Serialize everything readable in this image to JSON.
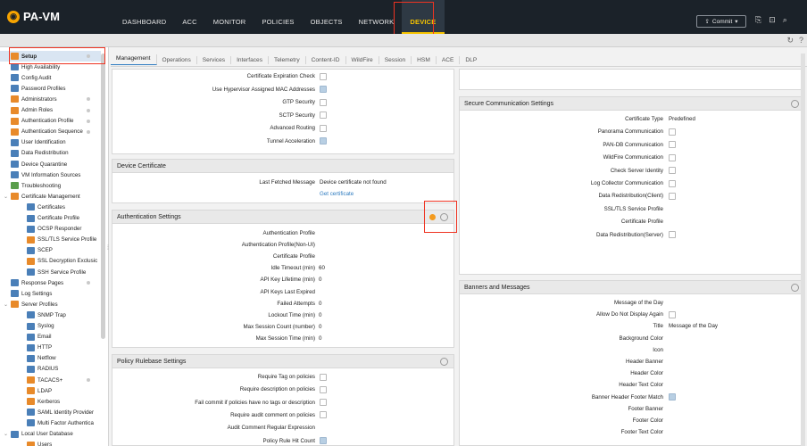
{
  "app": {
    "logo_text": "PA-VM"
  },
  "nav": {
    "items": [
      "DASHBOARD",
      "ACC",
      "MONITOR",
      "POLICIES",
      "OBJECTS",
      "NETWORK",
      "DEVICE"
    ],
    "active": "DEVICE"
  },
  "toolbar": {
    "commit_label": "Commit"
  },
  "sidebar": {
    "items": [
      {
        "label": "Setup",
        "level": 0,
        "icon": "setup-icon",
        "selected": true,
        "dot": true
      },
      {
        "label": "High Availability",
        "level": 0,
        "icon": "ha-icon"
      },
      {
        "label": "Config Audit",
        "level": 0,
        "icon": "audit-icon"
      },
      {
        "label": "Password Profiles",
        "level": 0,
        "icon": "password-icon"
      },
      {
        "label": "Administrators",
        "level": 0,
        "icon": "admin-icon",
        "dot": true
      },
      {
        "label": "Admin Roles",
        "level": 0,
        "icon": "roles-icon",
        "dot": true
      },
      {
        "label": "Authentication Profile",
        "level": 0,
        "icon": "auth-profile-icon",
        "dot": true
      },
      {
        "label": "Authentication Sequence",
        "level": 0,
        "icon": "auth-seq-icon",
        "dot": true
      },
      {
        "label": "User Identification",
        "level": 0,
        "icon": "user-id-icon"
      },
      {
        "label": "Data Redistribution",
        "level": 0,
        "icon": "data-redist-icon"
      },
      {
        "label": "Device Quarantine",
        "level": 0,
        "icon": "quarantine-icon"
      },
      {
        "label": "VM Information Sources",
        "level": 0,
        "icon": "vm-icon"
      },
      {
        "label": "Troubleshooting",
        "level": 0,
        "icon": "troubleshoot-icon"
      },
      {
        "label": "Certificate Management",
        "level": 0,
        "icon": "cert-mgmt-icon",
        "expanded": true
      },
      {
        "label": "Certificates",
        "level": 1,
        "icon": "certificate-icon"
      },
      {
        "label": "Certificate Profile",
        "level": 1,
        "icon": "cert-profile-icon"
      },
      {
        "label": "OCSP Responder",
        "level": 1,
        "icon": "ocsp-icon"
      },
      {
        "label": "SSL/TLS Service Profile",
        "level": 1,
        "icon": "ssl-profile-icon"
      },
      {
        "label": "SCEP",
        "level": 1,
        "icon": "scep-icon"
      },
      {
        "label": "SSL Decryption Exclusic",
        "level": 1,
        "icon": "ssl-excl-icon"
      },
      {
        "label": "SSH Service Profile",
        "level": 1,
        "icon": "ssh-icon"
      },
      {
        "label": "Response Pages",
        "level": 0,
        "icon": "response-icon",
        "dot": true
      },
      {
        "label": "Log Settings",
        "level": 0,
        "icon": "log-icon"
      },
      {
        "label": "Server Profiles",
        "level": 0,
        "icon": "server-profiles-icon",
        "expanded": true
      },
      {
        "label": "SNMP Trap",
        "level": 1,
        "icon": "snmp-icon"
      },
      {
        "label": "Syslog",
        "level": 1,
        "icon": "syslog-icon"
      },
      {
        "label": "Email",
        "level": 1,
        "icon": "email-icon"
      },
      {
        "label": "HTTP",
        "level": 1,
        "icon": "http-icon"
      },
      {
        "label": "Netflow",
        "level": 1,
        "icon": "netflow-icon"
      },
      {
        "label": "RADIUS",
        "level": 1,
        "icon": "radius-icon"
      },
      {
        "label": "TACACS+",
        "level": 1,
        "icon": "tacacs-icon",
        "dot": true
      },
      {
        "label": "LDAP",
        "level": 1,
        "icon": "ldap-icon"
      },
      {
        "label": "Kerberos",
        "level": 1,
        "icon": "kerberos-icon"
      },
      {
        "label": "SAML Identity Provider",
        "level": 1,
        "icon": "saml-icon"
      },
      {
        "label": "Multi Factor Authentica",
        "level": 1,
        "icon": "mfa-icon"
      },
      {
        "label": "Local User Database",
        "level": 0,
        "icon": "local-db-icon",
        "expanded": true
      },
      {
        "label": "Users",
        "level": 1,
        "icon": "users-icon"
      }
    ]
  },
  "tabs": [
    "Management",
    "Operations",
    "Services",
    "Interfaces",
    "Telemetry",
    "Content-ID",
    "WildFire",
    "Session",
    "HSM",
    "ACE",
    "DLP"
  ],
  "general": {
    "rows": [
      {
        "label": "Certificate Expiration Check",
        "checked": false
      },
      {
        "label": "Use Hypervisor Assigned MAC Addresses",
        "checked": true
      },
      {
        "label": "GTP Security",
        "checked": false
      },
      {
        "label": "SCTP Security",
        "checked": false
      },
      {
        "label": "Advanced Routing",
        "checked": false
      },
      {
        "label": "Tunnel Acceleration",
        "checked": true
      }
    ]
  },
  "device_certificate": {
    "title": "Device Certificate",
    "last_fetched_label": "Last Fetched Message",
    "last_fetched_value": "Device certificate not found",
    "get_link": "Get certificate"
  },
  "auth_settings": {
    "title": "Authentication Settings",
    "rows": [
      {
        "label": "Authentication Profile",
        "value": ""
      },
      {
        "label": "Authentication Profile(Non-UI)",
        "value": ""
      },
      {
        "label": "Certificate Profile",
        "value": ""
      },
      {
        "label": "Idle Timeout (min)",
        "value": "60"
      },
      {
        "label": "API Key Lifetime (min)",
        "value": "0"
      },
      {
        "label": "API Keys Last Expired",
        "value": ""
      },
      {
        "label": "Failed Attempts",
        "value": "0"
      },
      {
        "label": "Lockout Time (min)",
        "value": "0"
      },
      {
        "label": "Max Session Count (number)",
        "value": "0"
      },
      {
        "label": "Max Session Time (min)",
        "value": "0"
      }
    ]
  },
  "policy_rulebase": {
    "title": "Policy Rulebase Settings",
    "rows": [
      {
        "label": "Require Tag on policies",
        "checked": false
      },
      {
        "label": "Require description on policies",
        "checked": false
      },
      {
        "label": "Fail commit if policies have no tags or description",
        "checked": false
      },
      {
        "label": "Require audit comment on policies",
        "checked": false
      },
      {
        "label": "Audit Comment Regular Expression",
        "checked": null
      },
      {
        "label": "Policy Rule Hit Count",
        "checked": true
      }
    ]
  },
  "secure_comm": {
    "title": "Secure Communication Settings",
    "rows": [
      {
        "label": "Certificate Type",
        "value": "Predefined",
        "checked": null
      },
      {
        "label": "Panorama Communication",
        "value": "",
        "checked": false
      },
      {
        "label": "PAN-DB Communication",
        "value": "",
        "checked": false
      },
      {
        "label": "WildFire Communication",
        "value": "",
        "checked": false
      },
      {
        "label": "Check Server Identity",
        "value": "",
        "checked": false
      },
      {
        "label": "Log Collector Communication",
        "value": "",
        "checked": false
      },
      {
        "label": "Data Redistribution(Client)",
        "value": "",
        "checked": false
      },
      {
        "label": "SSL/TLS Service Profile",
        "value": "",
        "checked": null
      },
      {
        "label": "Certificate Profile",
        "value": "",
        "checked": null
      },
      {
        "label": "Data Redistribution(Server)",
        "value": "",
        "checked": false
      }
    ]
  },
  "banners": {
    "title": "Banners and Messages",
    "rows": [
      {
        "label": "Message of the Day",
        "value": "",
        "checked": null
      },
      {
        "label": "Allow Do Not Display Again",
        "value": "",
        "checked": false
      },
      {
        "label": "Title",
        "value": "Message of the Day",
        "checked": null
      },
      {
        "label": "Background Color",
        "value": "",
        "checked": null
      },
      {
        "label": "Icon",
        "value": "",
        "checked": null
      },
      {
        "label": "Header Banner",
        "value": "",
        "checked": null
      },
      {
        "label": "Header Color",
        "value": "",
        "checked": null
      },
      {
        "label": "Header Text Color",
        "value": "",
        "checked": null
      },
      {
        "label": "Banner Header Footer Match",
        "value": "",
        "checked": true
      },
      {
        "label": "Footer Banner",
        "value": "",
        "checked": null
      },
      {
        "label": "Footer Color",
        "value": "",
        "checked": null
      },
      {
        "label": "Footer Text Color",
        "value": "",
        "checked": null
      }
    ]
  },
  "colors": {
    "accent": "#f7c400",
    "highlight": "#e32222",
    "nav_bg": "#1b2229"
  }
}
